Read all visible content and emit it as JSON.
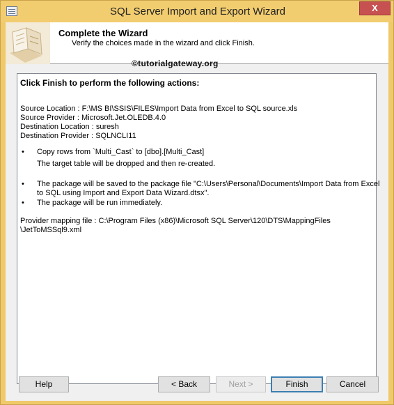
{
  "window": {
    "title": "SQL Server Import and Export Wizard",
    "close_glyph": "X"
  },
  "header": {
    "title": "Complete the Wizard",
    "subtitle": "Verify the choices made in the wizard and click Finish."
  },
  "watermark": "©tutorialgateway.org",
  "report": {
    "heading": "Click Finish to perform the following actions:",
    "source_location": "Source Location : F:\\MS BI\\SSIS\\FILES\\Import Data from Excel to SQL source.xls",
    "source_provider": "Source Provider : Microsoft.Jet.OLEDB.4.0",
    "destination_location": "Destination Location : suresh",
    "destination_provider": "Destination Provider : SQLNCLI11",
    "bullet_glyph": "•",
    "copy_rows": "Copy rows from `Multi_Cast` to [dbo].[Multi_Cast]",
    "copy_rows_note": "The target table will be dropped and then re-created.",
    "package_saved_1": "The package will be saved to the package file \"C:\\Users\\Personal\\Documents\\Import Data from Excel",
    "package_saved_2": "to SQL using Import and Export Data Wizard.dtsx\".",
    "package_run": "The package will be run immediately.",
    "mapping_file_1": "Provider mapping file : C:\\Program Files (x86)\\Microsoft SQL Server\\120\\DTS\\MappingFiles",
    "mapping_file_2": "\\JetToMSSql9.xml"
  },
  "buttons": {
    "help": "Help",
    "back": "< Back",
    "next": "Next >",
    "finish": "Finish",
    "cancel": "Cancel"
  }
}
